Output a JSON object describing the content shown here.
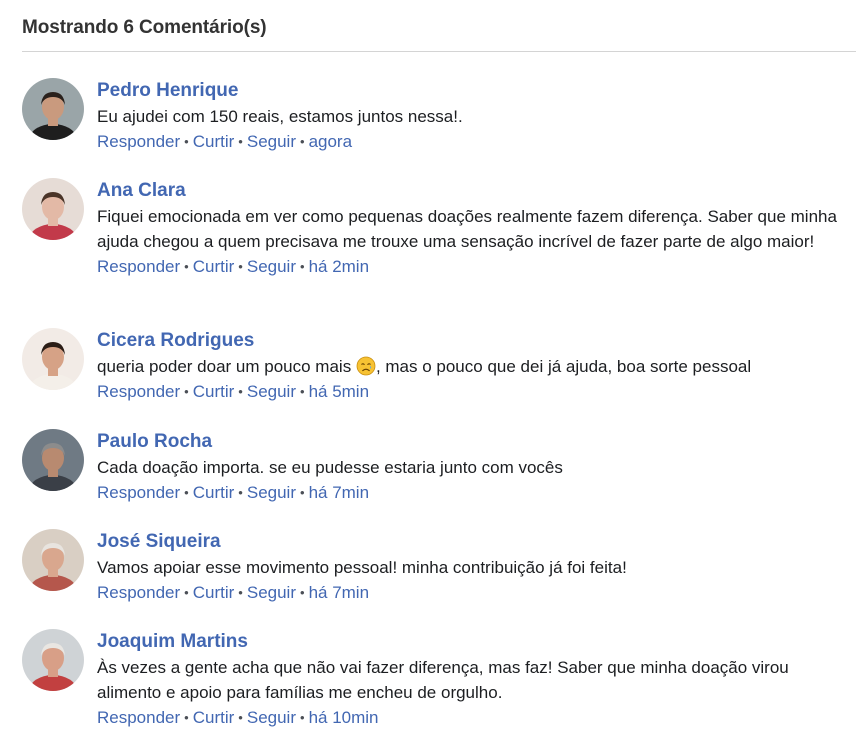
{
  "header": {
    "title": "Mostrando 6 Comentário(s)"
  },
  "actions": {
    "reply": "Responder",
    "like": "Curtir",
    "follow": "Seguir",
    "separator": "•"
  },
  "comments": [
    {
      "author": "Pedro Henrique",
      "text": "Eu ajudei com 150 reais, estamos juntos nessa!.",
      "time": "agora",
      "avatar": {
        "bg": "#9aa5a8",
        "skin": "#c99a7e",
        "hair": "#2a211c",
        "shirt": "#1e1e1e"
      }
    },
    {
      "author": "Ana Clara",
      "text": "Fiquei emocionada em ver como pequenas doações realmente fazem diferença. Saber que minha ajuda chegou a quem precisava me trouxe uma sensação incrível de fazer parte de algo maior!",
      "time": "há 2min",
      "avatar": {
        "bg": "#e6dcd6",
        "skin": "#e3b9a6",
        "hair": "#4a3428",
        "shirt": "#c23a4a"
      }
    },
    {
      "author": "Cicera Rodrigues",
      "text_before": "queria poder doar um pouco mais ",
      "text_after": ", mas o pouco que dei já ajuda, boa sorte pessoal",
      "emoji": "sad-face-emoji",
      "time": "há 5min",
      "avatar": {
        "bg": "#f2ebe6",
        "skin": "#d6a286",
        "hair": "#2b1d16",
        "shirt": "#f4efe9"
      }
    },
    {
      "author": "Paulo Rocha",
      "text": "Cada doação importa. se eu pudesse estaria junto com vocês",
      "time": "há 7min",
      "avatar": {
        "bg": "#6f7a84",
        "skin": "#b88a70",
        "hair": "#8c8c8c",
        "shirt": "#3a3f47"
      }
    },
    {
      "author": "José Siqueira",
      "text": "Vamos apoiar esse movimento pessoal! minha contribuição já foi feita!",
      "time": "há 7min",
      "avatar": {
        "bg": "#d9cfc4",
        "skin": "#d9a78e",
        "hair": "#e8e4df",
        "shirt": "#b5574c"
      }
    },
    {
      "author": "Joaquim Martins",
      "text": "Às vezes a gente acha que não vai fazer diferença, mas faz! Saber que minha doação virou alimento e apoio para famílias me encheu de orgulho.",
      "time": "há 10min",
      "avatar": {
        "bg": "#cfd3d6",
        "skin": "#d89f87",
        "hair": "#e9e6e2",
        "shirt": "#c24040"
      }
    }
  ]
}
